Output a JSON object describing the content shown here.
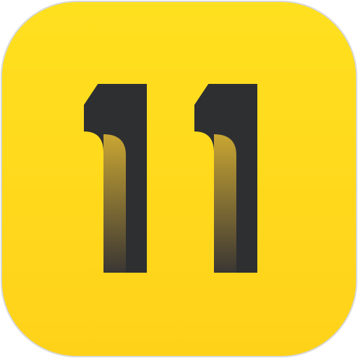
{
  "app_icon": {
    "glyph_text": "11",
    "icon_name": "number-eleven-icon",
    "colors": {
      "background_top": "#FFE01F",
      "background_bottom": "#FFD21A",
      "border": "#D8D8D8",
      "glyph": "#2E2F31",
      "gradient_light": "#C9A633",
      "gradient_dark": "#3A3633"
    }
  }
}
